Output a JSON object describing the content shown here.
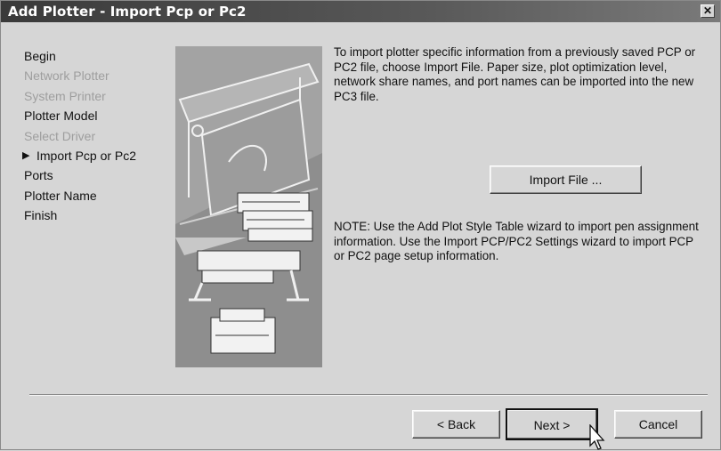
{
  "window": {
    "title": "Add Plotter - Import Pcp or Pc2",
    "close_glyph": "✕"
  },
  "steps": [
    {
      "label": "Begin",
      "state": "normal"
    },
    {
      "label": "Network Plotter",
      "state": "disabled"
    },
    {
      "label": "System Printer",
      "state": "disabled"
    },
    {
      "label": "Plotter Model",
      "state": "normal"
    },
    {
      "label": "Select Driver",
      "state": "disabled"
    },
    {
      "label": "Import Pcp or Pc2",
      "state": "current"
    },
    {
      "label": "Ports",
      "state": "normal"
    },
    {
      "label": "Plotter Name",
      "state": "normal"
    },
    {
      "label": "Finish",
      "state": "normal"
    }
  ],
  "current_marker": "▶",
  "main": {
    "intro_text": "To import plotter specific information from a previously saved PCP or PC2 file, choose Import File. Paper size, plot optimization level, network share names, and port names can be imported into the new PC3 file.",
    "import_button": "Import File ...",
    "note_text": "NOTE: Use the Add Plot Style Table wizard to import pen assignment information. Use the Import PCP/PC2 Settings wizard to import PCP or PC2 page setup information."
  },
  "footer": {
    "back": "< Back",
    "next": "Next >",
    "cancel": "Cancel"
  },
  "colors": {
    "titlebar": "#3a3a3a",
    "face": "#d6d6d6",
    "disabled_text": "#9e9e9e"
  }
}
